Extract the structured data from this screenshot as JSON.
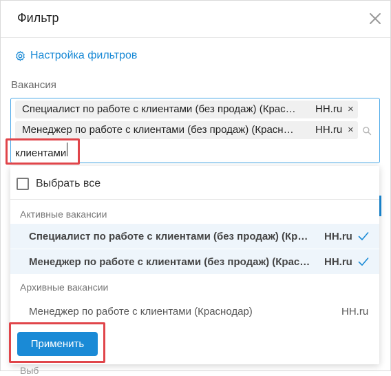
{
  "header": {
    "title": "Фильтр"
  },
  "settings": {
    "label": "Настройка фильтров"
  },
  "vacancy_field": {
    "label": "Вакансия",
    "chips": [
      {
        "text": "Специалист по работе с клиентами (без продаж) (Краснодар)",
        "source": "HH.ru",
        "remove": "×"
      },
      {
        "text": "Менеджер по работе с клиентами (без продаж) (Краснодар)",
        "source": "HH.ru",
        "remove": "×"
      }
    ],
    "search_value": "клиентами"
  },
  "dropdown": {
    "select_all_label": "Выбрать все",
    "active_group_label": "Активные вакансии",
    "archive_group_label": "Архивные вакансии",
    "active_options": [
      {
        "text": "Специалист по работе с клиентами (без продаж) (Краснодар)",
        "source": "HH.ru",
        "selected": true
      },
      {
        "text": "Менеджер по работе с клиентами (без продаж) (Краснодар)",
        "source": "HH.ru",
        "selected": true
      }
    ],
    "archive_options": [
      {
        "text": "Менеджер по работе с клиентами (Краснодар)",
        "source": "HH.ru",
        "selected": false
      }
    ],
    "apply_label": "Применить"
  },
  "footer": {
    "partial_label": "Выб"
  },
  "colors": {
    "accent": "#1a8ad6",
    "highlight": "#e0454a",
    "selected_row": "#eef5fb"
  }
}
